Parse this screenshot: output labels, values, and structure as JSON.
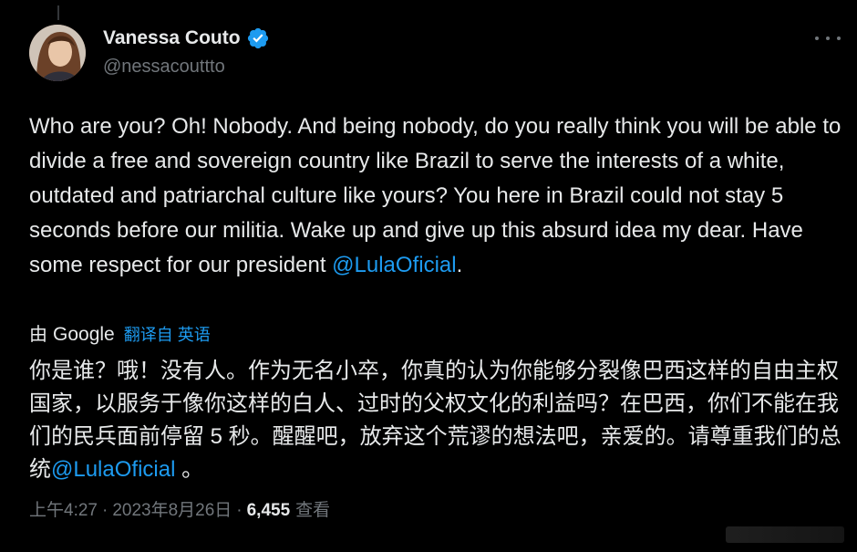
{
  "author": {
    "display_name": "Vanessa Couto",
    "handle": "@nessacouttto",
    "verified": true
  },
  "tweet": {
    "text_before_mention": "Who are you? Oh! Nobody. And being nobody, do you really think you will be able to divide a free and sovereign country like Brazil to serve the interests of a white, outdated and patriarchal culture like yours? You here in Brazil could not stay 5 seconds before our militia. Wake up and give up this absurd idea my dear. Have some respect for our president ",
    "mention": "@LulaOficial",
    "text_after_mention": "."
  },
  "translation": {
    "by_label": "由",
    "provider": "Google",
    "link_label": "翻译自 英语",
    "text_before_mention": "你是谁？哦！没有人。作为无名小卒，你真的认为你能够分裂像巴西这样的自由主权国家，以服务于像你这样的白人、过时的父权文化的利益吗？在巴西，你们不能在我们的民兵面前停留 5 秒。醒醒吧，放弃这个荒谬的想法吧，亲爱的。请尊重我们的总统",
    "mention": "@LulaOficial",
    "text_after_mention": " 。"
  },
  "meta": {
    "time": "上午4:27",
    "separator": "·",
    "date": "2023年8月26日",
    "views_count": "6,455",
    "views_label": "查看"
  },
  "colors": {
    "background": "#000000",
    "text": "#e7e9ea",
    "secondary": "#71767b",
    "accent": "#1d9bf0"
  },
  "icons": {
    "verified": "verified-badge-icon",
    "more": "more-options-icon"
  }
}
